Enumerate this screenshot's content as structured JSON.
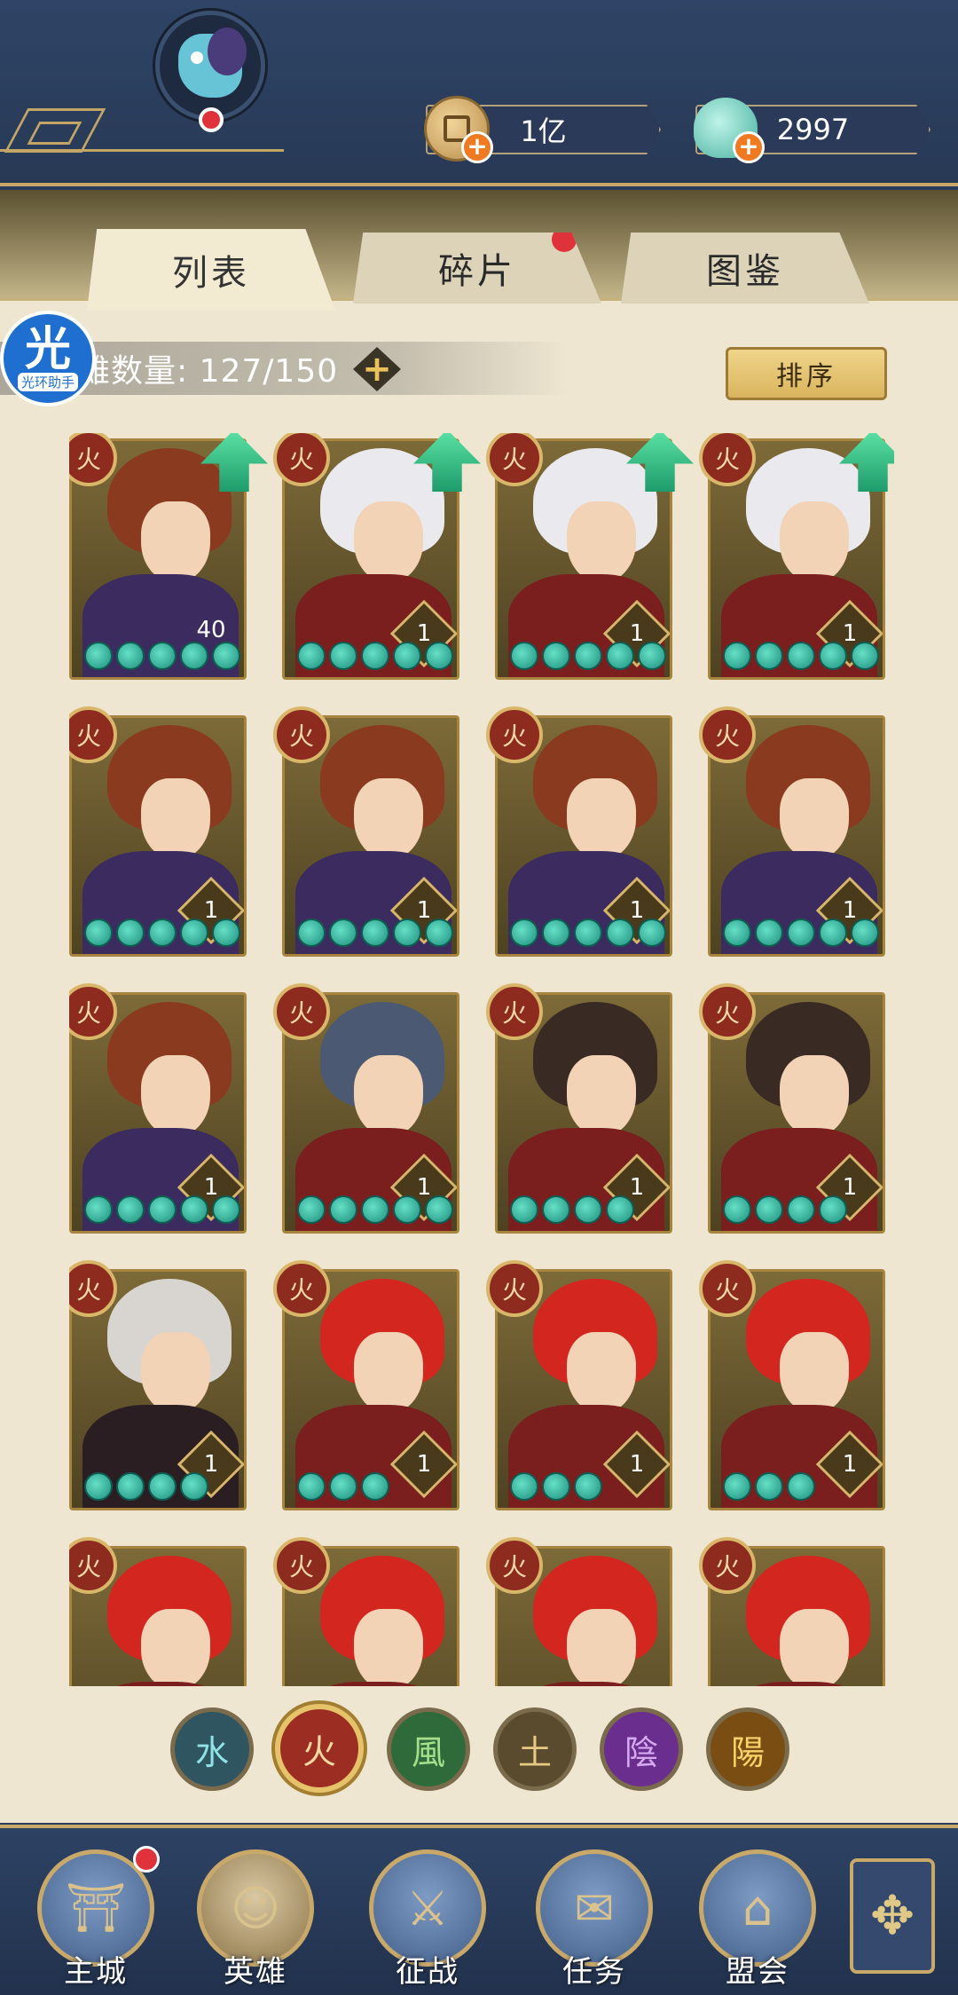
{
  "header": {
    "gold_amount": "1亿",
    "jade_amount": "2997",
    "plus_symbol": "+"
  },
  "tabs": [
    {
      "label": "列表",
      "active": true,
      "has_dot": false
    },
    {
      "label": "碎片",
      "active": false,
      "has_dot": true
    },
    {
      "label": "图鉴",
      "active": false,
      "has_dot": false
    }
  ],
  "list": {
    "count_text": "雄数量: 127/150",
    "add_symbol": "+",
    "sort_label": "排序"
  },
  "helper": {
    "big": "光",
    "small": "光环助手"
  },
  "hero_element_glyph": "火",
  "heroes": [
    {
      "level": "40",
      "stars": 5,
      "up": true,
      "type": "brown"
    },
    {
      "level": "1",
      "stars": 5,
      "up": true,
      "type": "white"
    },
    {
      "level": "1",
      "stars": 5,
      "up": true,
      "type": "white"
    },
    {
      "level": "1",
      "stars": 5,
      "up": true,
      "type": "white"
    },
    {
      "level": "1",
      "stars": 5,
      "up": false,
      "type": "brown"
    },
    {
      "level": "1",
      "stars": 5,
      "up": false,
      "type": "brown"
    },
    {
      "level": "1",
      "stars": 5,
      "up": false,
      "type": "brown"
    },
    {
      "level": "1",
      "stars": 5,
      "up": false,
      "type": "brown"
    },
    {
      "level": "1",
      "stars": 5,
      "up": false,
      "type": "brown"
    },
    {
      "level": "1",
      "stars": 5,
      "up": false,
      "type": "grey"
    },
    {
      "level": "1",
      "stars": 4,
      "up": false,
      "type": "dark"
    },
    {
      "level": "1",
      "stars": 4,
      "up": false,
      "type": "girl"
    },
    {
      "level": "1",
      "stars": 4,
      "up": false,
      "type": "silver"
    },
    {
      "level": "1",
      "stars": 3,
      "up": false,
      "type": "red"
    },
    {
      "level": "1",
      "stars": 3,
      "up": false,
      "type": "red"
    },
    {
      "level": "1",
      "stars": 3,
      "up": false,
      "type": "red"
    },
    {
      "level": "",
      "stars": 0,
      "up": false,
      "type": "red"
    },
    {
      "level": "",
      "stars": 0,
      "up": false,
      "type": "red"
    },
    {
      "level": "",
      "stars": 0,
      "up": false,
      "type": "red"
    },
    {
      "level": "",
      "stars": 0,
      "up": false,
      "type": "red"
    }
  ],
  "filters": [
    {
      "glyph": "水",
      "name": "water",
      "bg": "#2f5560",
      "fg": "#8fe3e6",
      "active": false
    },
    {
      "glyph": "火",
      "name": "fire",
      "bg": "#9b2d22",
      "fg": "#f5d9a0",
      "active": true
    },
    {
      "glyph": "風",
      "name": "wind",
      "bg": "#2e6a3a",
      "fg": "#a6e08c",
      "active": false
    },
    {
      "glyph": "土",
      "name": "earth",
      "bg": "#5a4a2e",
      "fg": "#e8c982",
      "active": false
    },
    {
      "glyph": "陰",
      "name": "yin",
      "bg": "#6a2f8e",
      "fg": "#d6a9f0",
      "active": false
    },
    {
      "glyph": "陽",
      "name": "yang",
      "bg": "#7a4e12",
      "fg": "#f7d36a",
      "active": false
    }
  ],
  "nav": [
    {
      "label": "主城",
      "icon": "castle-icon",
      "glyph": "⛩",
      "active": false,
      "dot": true
    },
    {
      "label": "英雄",
      "icon": "hero-icon",
      "glyph": "☺",
      "active": true,
      "dot": false
    },
    {
      "label": "征战",
      "icon": "battle-icon",
      "glyph": "⚔",
      "active": false,
      "dot": false
    },
    {
      "label": "任务",
      "icon": "task-icon",
      "glyph": "✉",
      "active": false,
      "dot": false
    },
    {
      "label": "盟会",
      "icon": "guild-icon",
      "glyph": "⌂",
      "active": false,
      "dot": false
    }
  ],
  "menu_glyph": "✥",
  "colors": {
    "hair_brown": "#8a3a1e",
    "hair_white": "#e9e9ee",
    "hair_grey": "#4b5a72",
    "hair_dark": "#3a2a24",
    "hair_red": "#d3261f",
    "hair_silver": "#d8d4d0",
    "body_purple": "#3b2b5e",
    "body_red": "#7a1e1e",
    "body_black": "#2a1e22"
  }
}
